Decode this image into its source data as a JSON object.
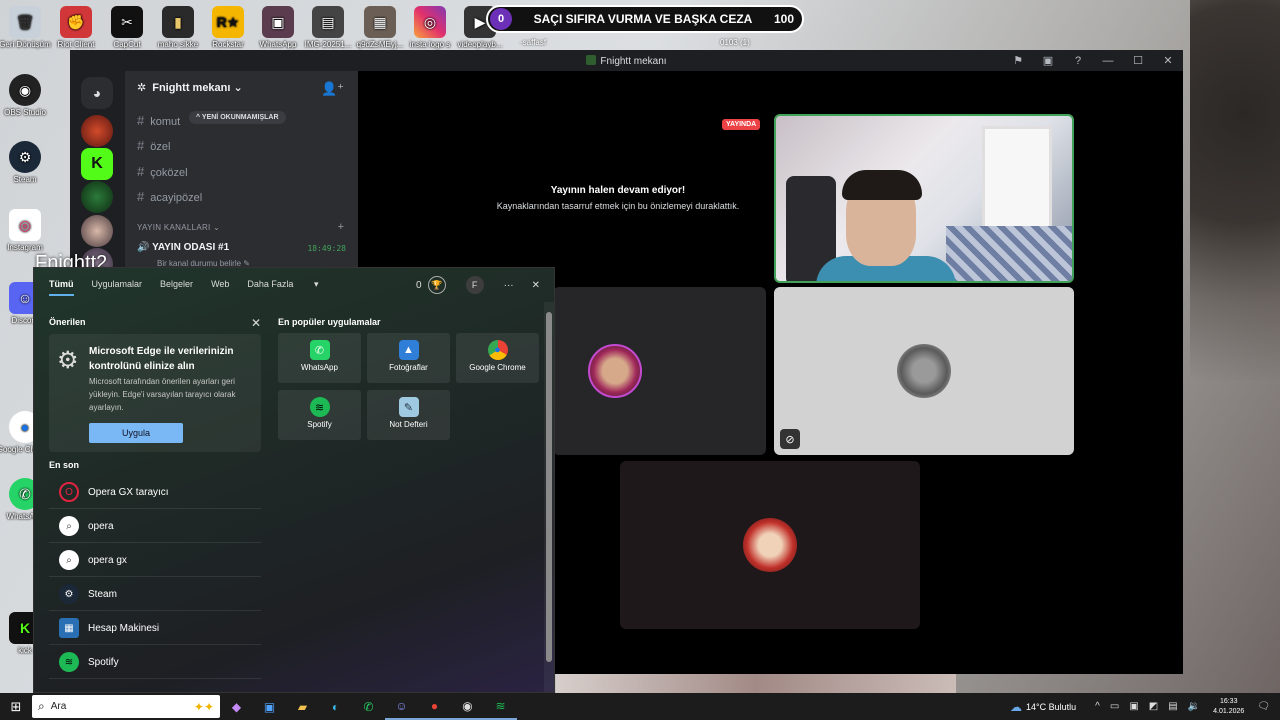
{
  "desktop_icons": [
    {
      "label": "Geri Dönüşüm",
      "icon": "recycle-bin-icon"
    },
    {
      "label": "Riot Client",
      "icon": "riot-icon"
    },
    {
      "label": "CapCut",
      "icon": "capcut-icon"
    },
    {
      "label": "maho sikke",
      "icon": "folder-icon"
    },
    {
      "label": "Rockstar",
      "icon": "rockstar-icon"
    },
    {
      "label": "WhatsApp",
      "icon": "whatsapp-icon"
    },
    {
      "label": "IMG-20251...",
      "icon": "image-icon"
    },
    {
      "label": "q9dZsMEyj...",
      "icon": "image-icon"
    },
    {
      "label": "insta logo s",
      "icon": "instagram-icon"
    },
    {
      "label": "videoplayb...",
      "icon": "video-icon"
    },
    {
      "label": "OBS Studio",
      "icon": "obs-icon"
    },
    {
      "label": "Steam",
      "icon": "steam-icon"
    },
    {
      "label": "Instagram",
      "icon": "instagram-icon"
    },
    {
      "label": "Discord",
      "icon": "discord-icon"
    },
    {
      "label": "Google Chrome",
      "icon": "chrome-icon"
    },
    {
      "label": "WhatsApp",
      "icon": "whatsapp-icon"
    },
    {
      "label": "kick",
      "icon": "kick-icon"
    }
  ],
  "overlay": {
    "left_count": "0",
    "headline": "SAÇI SIFIRA VURMA VE BAŞKA CEZA",
    "right_count": "100",
    "sub_left": "-saffasf",
    "sub_right": "0103 (1)",
    "streamer_name": "Fnightt2"
  },
  "discord": {
    "window_title": "Fnightt mekanı",
    "server_name": "Fnightt mekanı",
    "channels": [
      "komut",
      "özel",
      "çoközel",
      "acayipözel"
    ],
    "unread_pill": "YENİ OKUNMAMIŞLAR",
    "category": "YAYIN KANALLARI",
    "voice_channel": "YAYIN ODASI #1",
    "voice_time": "18:49:28",
    "voice_status": "Bir kanal durumu belirle",
    "live_badge": "YAYINDA",
    "paused_title": "Yayının halen devam ediyor!",
    "paused_sub": "Kaynaklarından tasarruf etmek için bu önizlemeyi duraklattık."
  },
  "start_menu": {
    "tabs": [
      "Tümü",
      "Uygulamalar",
      "Belgeler",
      "Web",
      "Daha Fazla"
    ],
    "points": "0",
    "user_initial": "F",
    "recommended_title": "Önerilen",
    "reco": {
      "title": "Microsoft Edge ile verilerinizin kontrolünü elinize alın",
      "desc": "Microsoft tarafından önerilen ayarları geri yükleyin. Edge'i varsayılan tarayıcı olarak ayarlayın.",
      "button": "Uygula"
    },
    "recent_title": "En son",
    "recent": [
      {
        "label": "Opera GX tarayıcı",
        "icon": "opera-gx-icon"
      },
      {
        "label": "opera",
        "icon": "search-icon"
      },
      {
        "label": "opera gx",
        "icon": "search-icon"
      },
      {
        "label": "Steam",
        "icon": "steam-icon"
      },
      {
        "label": "Hesap Makinesi",
        "icon": "calculator-icon"
      },
      {
        "label": "Spotify",
        "icon": "spotify-icon"
      }
    ],
    "popular_title": "En popüler uygulamalar",
    "popular": [
      {
        "label": "WhatsApp",
        "icon": "whatsapp-icon"
      },
      {
        "label": "Fotoğraflar",
        "icon": "photos-icon"
      },
      {
        "label": "Google Chrome",
        "icon": "chrome-icon"
      },
      {
        "label": "Spotify",
        "icon": "spotify-icon"
      },
      {
        "label": "Not Defteri",
        "icon": "notepad-icon"
      }
    ]
  },
  "taskbar": {
    "search_placeholder": "Ara",
    "weather": "14°C  Bulutlu",
    "time": "16:33",
    "date": "4.01.2026"
  }
}
